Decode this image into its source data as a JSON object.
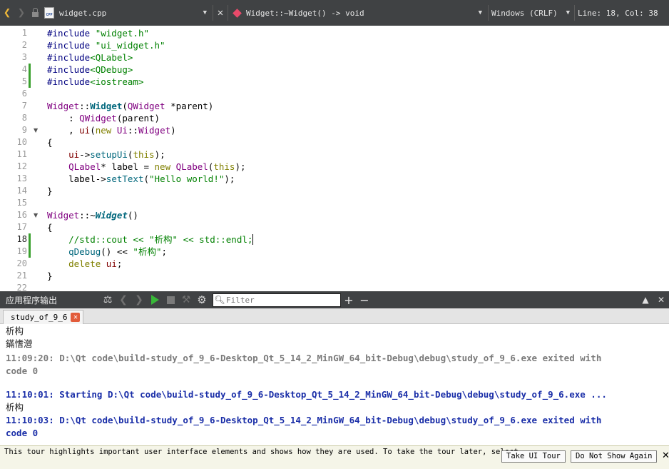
{
  "toolbar": {
    "file_name": "widget.cpp",
    "file_icon_label": "CPP",
    "function": "Widget::~Widget() -> void",
    "line_ending": "Windows (CRLF)",
    "cursor_position": "Line: 18, Col: 38",
    "drop_arrow": "▼",
    "close_glyph": "✕"
  },
  "editor": {
    "line_numbers": [
      "1",
      "2",
      "3",
      "4",
      "5",
      "6",
      "7",
      "8",
      "9",
      "10",
      "11",
      "12",
      "13",
      "14",
      "15",
      "16",
      "17",
      "18",
      "19",
      "20",
      "21",
      "22"
    ],
    "lines": [
      [
        {
          "c": "pp",
          "t": "#include "
        },
        {
          "c": "str",
          "t": "\"widget.h\""
        }
      ],
      [
        {
          "c": "pp",
          "t": "#include "
        },
        {
          "c": "str",
          "t": "\"ui_widget.h\""
        }
      ],
      [
        {
          "c": "pp",
          "t": "#include"
        },
        {
          "c": "str",
          "t": "<QLabel>"
        }
      ],
      [
        {
          "c": "pp",
          "t": "#include"
        },
        {
          "c": "str",
          "t": "<QDebug>"
        }
      ],
      [
        {
          "c": "pp",
          "t": "#include"
        },
        {
          "c": "str",
          "t": "<iostream>"
        }
      ],
      [],
      [
        {
          "c": "ty",
          "t": "Widget"
        },
        {
          "c": "pl",
          "t": "::"
        },
        {
          "c": "fnd",
          "t": "Widget"
        },
        {
          "c": "pl",
          "t": "("
        },
        {
          "c": "ty",
          "t": "QWidget"
        },
        {
          "c": "pl",
          "t": " *"
        },
        {
          "c": "pl",
          "t": "parent)"
        }
      ],
      [
        {
          "c": "pl",
          "t": "    : "
        },
        {
          "c": "ty",
          "t": "QWidget"
        },
        {
          "c": "pl",
          "t": "(parent)"
        }
      ],
      [
        {
          "c": "pl",
          "t": "    , "
        },
        {
          "c": "mem",
          "t": "ui"
        },
        {
          "c": "pl",
          "t": "("
        },
        {
          "c": "kw",
          "t": "new "
        },
        {
          "c": "ns",
          "t": "Ui"
        },
        {
          "c": "pl",
          "t": "::"
        },
        {
          "c": "ty",
          "t": "Widget"
        },
        {
          "c": "pl",
          "t": ")"
        }
      ],
      [
        {
          "c": "pl",
          "t": "{"
        }
      ],
      [
        {
          "c": "pl",
          "t": "    "
        },
        {
          "c": "mem",
          "t": "ui"
        },
        {
          "c": "pl",
          "t": "->"
        },
        {
          "c": "fn",
          "t": "setupUi"
        },
        {
          "c": "pl",
          "t": "("
        },
        {
          "c": "kw",
          "t": "this"
        },
        {
          "c": "pl",
          "t": ");"
        }
      ],
      [
        {
          "c": "pl",
          "t": "    "
        },
        {
          "c": "ty",
          "t": "QLabel"
        },
        {
          "c": "pl",
          "t": "* label = "
        },
        {
          "c": "kw",
          "t": "new "
        },
        {
          "c": "ty",
          "t": "QLabel"
        },
        {
          "c": "pl",
          "t": "("
        },
        {
          "c": "kw",
          "t": "this"
        },
        {
          "c": "pl",
          "t": ");"
        }
      ],
      [
        {
          "c": "pl",
          "t": "    label->"
        },
        {
          "c": "fn",
          "t": "setText"
        },
        {
          "c": "pl",
          "t": "("
        },
        {
          "c": "str",
          "t": "\"Hello world!\""
        },
        {
          "c": "pl",
          "t": ");"
        }
      ],
      [
        {
          "c": "pl",
          "t": "}"
        }
      ],
      [],
      [
        {
          "c": "ty",
          "t": "Widget"
        },
        {
          "c": "pl",
          "t": "::~"
        },
        {
          "c": "fni",
          "t": "Widget"
        },
        {
          "c": "pl",
          "t": "()"
        }
      ],
      [
        {
          "c": "pl",
          "t": "{"
        }
      ],
      [
        {
          "c": "pl",
          "t": "    "
        },
        {
          "c": "cm",
          "t": "//std::cout << \"析构\" << std::endl;"
        }
      ],
      [
        {
          "c": "pl",
          "t": "    "
        },
        {
          "c": "fn",
          "t": "qDebug"
        },
        {
          "c": "pl",
          "t": "() << "
        },
        {
          "c": "str",
          "t": "\"析构\""
        },
        {
          "c": "pl",
          "t": ";"
        }
      ],
      [
        {
          "c": "pl",
          "t": "    "
        },
        {
          "c": "kw",
          "t": "delete "
        },
        {
          "c": "mem",
          "t": "ui"
        },
        {
          "c": "pl",
          "t": ";"
        }
      ],
      [
        {
          "c": "pl",
          "t": "}"
        }
      ],
      []
    ],
    "fold_lines": [
      9,
      16
    ],
    "changed_lines": [
      4,
      5,
      18,
      19
    ],
    "current_line": 18,
    "fold_glyph": "▼"
  },
  "output": {
    "title": "应用程序输出",
    "filter_placeholder": "Filter",
    "tab_label": "study_of_9_6",
    "lines": [
      {
        "style": "plain",
        "text": "析构"
      },
      {
        "style": "plain",
        "text": "鏋愭瀯"
      },
      {
        "style": "gray",
        "text": "11:09:20: D:\\Qt code\\build-study_of_9_6-Desktop_Qt_5_14_2_MinGW_64_bit-Debug\\debug\\study_of_9_6.exe exited with"
      },
      {
        "style": "gray",
        "text": "code 0"
      },
      {
        "style": "blank",
        "text": ""
      },
      {
        "style": "blue",
        "text": "11:10:01: Starting D:\\Qt code\\build-study_of_9_6-Desktop_Qt_5_14_2_MinGW_64_bit-Debug\\debug\\study_of_9_6.exe ..."
      },
      {
        "style": "plain",
        "text": "析构"
      },
      {
        "style": "blue",
        "text": "11:10:03: D:\\Qt code\\build-study_of_9_6-Desktop_Qt_5_14_2_MinGW_64_bit-Debug\\debug\\study_of_9_6.exe exited with"
      },
      {
        "style": "blue",
        "text": "code 0"
      }
    ]
  },
  "tour": {
    "message": "This tour highlights important user interface elements and shows how they are used. To take the tour later, select",
    "take_tour_label": "Take UI Tour",
    "dont_show_label": "Do Not Show Again",
    "close_glyph": "✕"
  }
}
